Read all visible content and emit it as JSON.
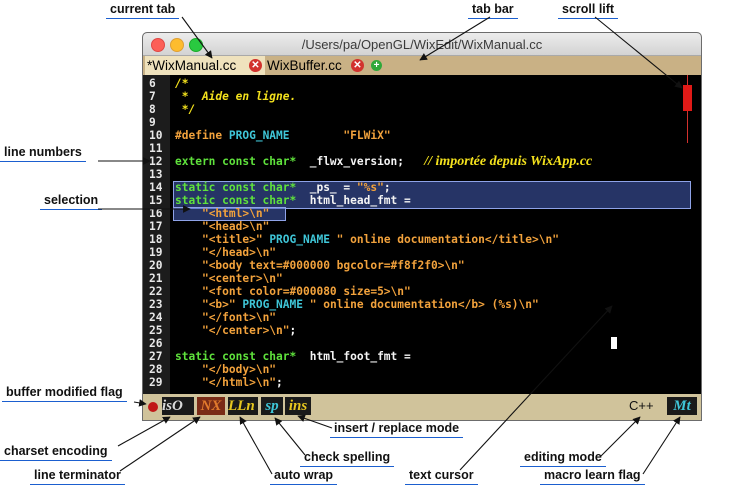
{
  "window": {
    "title": "/Users/pa/OpenGL/WixEdit/WixManual.cc",
    "tabs": [
      {
        "label": "*WixManual.cc",
        "active": true
      },
      {
        "label": "WixBuffer.cc",
        "active": false
      }
    ],
    "close_glyph": "✕",
    "add_glyph": "+"
  },
  "code_lines": [
    {
      "n": "6",
      "segs": [
        {
          "t": "/*",
          "c": "yel"
        }
      ]
    },
    {
      "n": "7",
      "segs": [
        {
          "t": " *  Aide en ligne.",
          "c": "yel"
        }
      ]
    },
    {
      "n": "8",
      "segs": [
        {
          "t": " */",
          "c": "yel"
        }
      ]
    },
    {
      "n": "9",
      "segs": []
    },
    {
      "n": "10",
      "segs": [
        {
          "t": "#define ",
          "c": "kw"
        },
        {
          "t": "PROG_NAME",
          "c": "cyan"
        },
        {
          "t": "        ",
          "c": "wht"
        },
        {
          "t": "\"FLWiX\"",
          "c": "str"
        }
      ]
    },
    {
      "n": "11",
      "segs": []
    },
    {
      "n": "12",
      "segs": [
        {
          "t": "extern const char* ",
          "c": "grn"
        },
        {
          "t": " _flwx_version;",
          "c": "wht"
        },
        {
          "t": "   ",
          "c": "wht"
        },
        {
          "t": "// importée depuis WixApp.cc",
          "c": "cmt"
        }
      ]
    },
    {
      "n": "13",
      "segs": []
    },
    {
      "n": "14",
      "segs": [
        {
          "t": "static const char* ",
          "c": "grn"
        },
        {
          "t": " _ps_ = ",
          "c": "wht"
        },
        {
          "t": "\"%s\"",
          "c": "str"
        },
        {
          "t": ";",
          "c": "wht"
        }
      ]
    },
    {
      "n": "15",
      "segs": [
        {
          "t": "static const char* ",
          "c": "grn"
        },
        {
          "t": " html_head_fmt =",
          "c": "wht"
        }
      ]
    },
    {
      "n": "16",
      "segs": [
        {
          "t": "    ",
          "c": "wht"
        },
        {
          "t": "\"<html>\\n\"",
          "c": "str"
        }
      ]
    },
    {
      "n": "17",
      "segs": [
        {
          "t": "    ",
          "c": "wht"
        },
        {
          "t": "\"<head>\\n\"",
          "c": "str"
        }
      ]
    },
    {
      "n": "18",
      "segs": [
        {
          "t": "    ",
          "c": "wht"
        },
        {
          "t": "\"<title>\" ",
          "c": "str"
        },
        {
          "t": "PROG_NAME",
          "c": "cyan"
        },
        {
          "t": " \" online documentation</title>\\n\"",
          "c": "str"
        }
      ]
    },
    {
      "n": "19",
      "segs": [
        {
          "t": "    ",
          "c": "wht"
        },
        {
          "t": "\"</head>\\n\"",
          "c": "str"
        }
      ]
    },
    {
      "n": "20",
      "segs": [
        {
          "t": "    ",
          "c": "wht"
        },
        {
          "t": "\"<body text=#000000 bgcolor=#f8f2f0>\\n\"",
          "c": "str"
        }
      ]
    },
    {
      "n": "21",
      "segs": [
        {
          "t": "    ",
          "c": "wht"
        },
        {
          "t": "\"<center>\\n\"",
          "c": "str"
        }
      ]
    },
    {
      "n": "22",
      "segs": [
        {
          "t": "    ",
          "c": "wht"
        },
        {
          "t": "\"<font color=#000080 size=5>\\n\"",
          "c": "str"
        }
      ]
    },
    {
      "n": "23",
      "segs": [
        {
          "t": "    ",
          "c": "wht"
        },
        {
          "t": "\"<b>\" ",
          "c": "str"
        },
        {
          "t": "PROG_NAME",
          "c": "cyan"
        },
        {
          "t": " \" online documentation</b> (%s)\\n\"",
          "c": "str"
        }
      ]
    },
    {
      "n": "24",
      "segs": [
        {
          "t": "    ",
          "c": "wht"
        },
        {
          "t": "\"</font>\\n\"",
          "c": "str"
        }
      ]
    },
    {
      "n": "25",
      "segs": [
        {
          "t": "    ",
          "c": "wht"
        },
        {
          "t": "\"</center>\\n\"",
          "c": "str"
        },
        {
          "t": ";",
          "c": "wht"
        }
      ]
    },
    {
      "n": "26",
      "segs": []
    },
    {
      "n": "27",
      "segs": [
        {
          "t": "static const char* ",
          "c": "grn"
        },
        {
          "t": " html_foot_fmt =",
          "c": "wht"
        }
      ]
    },
    {
      "n": "28",
      "segs": [
        {
          "t": "    ",
          "c": "wht"
        },
        {
          "t": "\"</body>\\n\"",
          "c": "str"
        }
      ]
    },
    {
      "n": "29",
      "segs": [
        {
          "t": "    ",
          "c": "wht"
        },
        {
          "t": "\"</html>\\n\"",
          "c": "str"
        },
        {
          "t": ";",
          "c": "wht"
        }
      ]
    }
  ],
  "statusbar": {
    "charset": "isO",
    "line_terminator": "NX",
    "auto_wrap": "LLn",
    "check_spelling": "sp",
    "insert_mode": "ins",
    "editing_mode": "C++",
    "macro_flag": "Mt"
  },
  "annotations": {
    "current_tab": "current tab",
    "tab_bar": "tab bar",
    "scroll_lift": "scroll lift",
    "line_numbers": "line numbers",
    "selection": "selection",
    "buffer_modified_flag": "buffer modified flag",
    "charset_encoding": "charset encoding",
    "line_terminator": "line terminator",
    "auto_wrap": "auto wrap",
    "check_spelling": "check spelling",
    "insert_replace_mode": "insert / replace mode",
    "text_cursor": "text cursor",
    "editing_mode": "editing mode",
    "macro_learn_flag": "macro learn flag"
  },
  "colors": {
    "comment": "#f4e21d",
    "keyword": "#f2a23c",
    "macro": "#3fc6d8",
    "type": "#5fe23c",
    "selection": "#465fb9",
    "statusbar": "#d0c39b",
    "tabbar": "#c9b185",
    "accent": "#1b5fcf"
  }
}
